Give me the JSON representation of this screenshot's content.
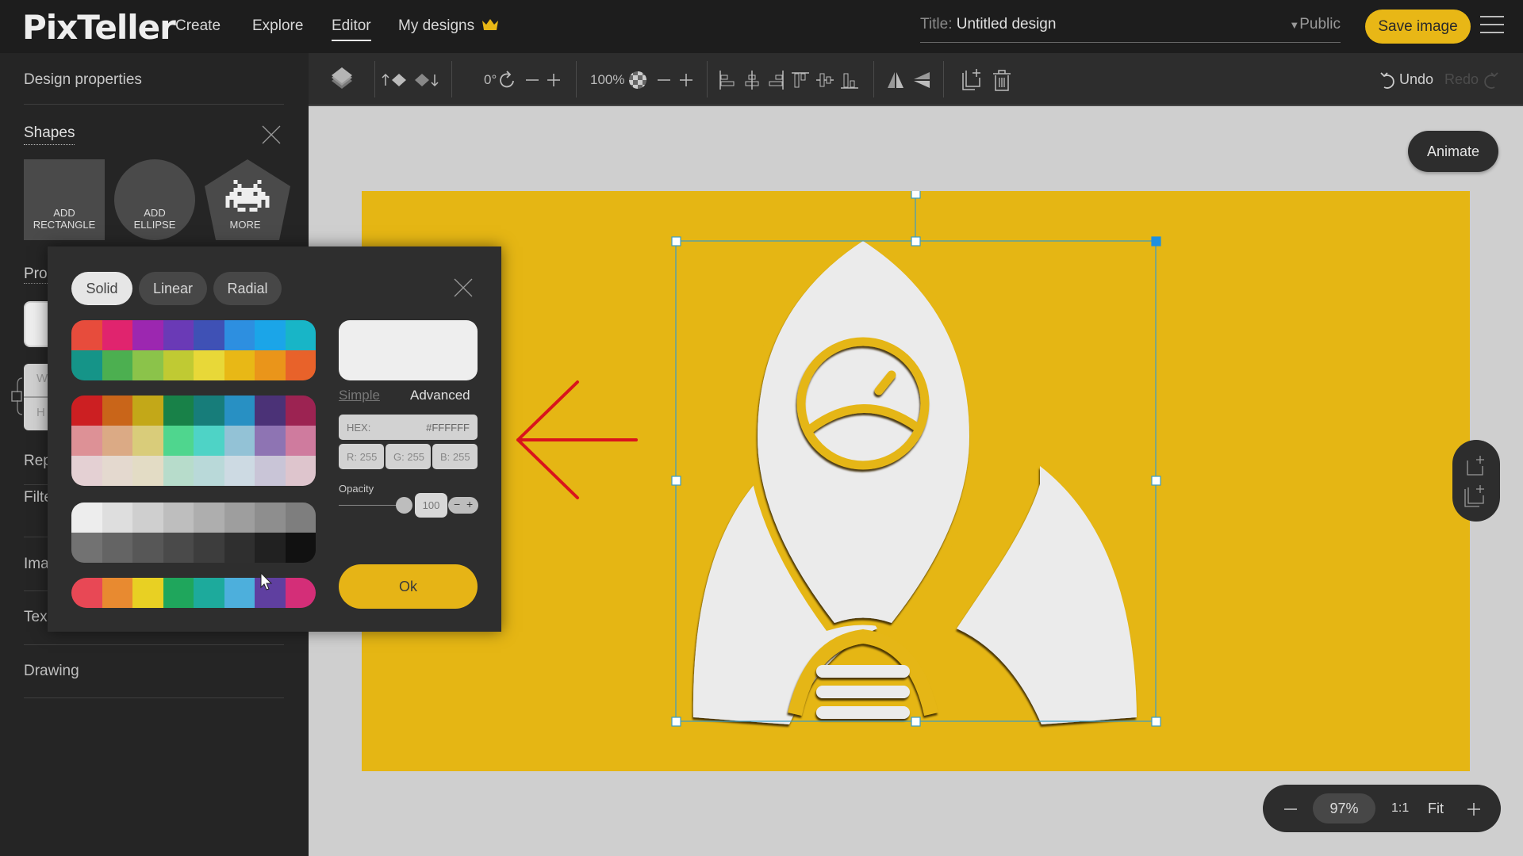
{
  "app": {
    "logo": "PixTeller",
    "nav": [
      {
        "label": "Create",
        "active": false
      },
      {
        "label": "Explore",
        "active": false
      },
      {
        "label": "Editor",
        "active": true
      },
      {
        "label": "My designs",
        "active": false,
        "icon": "crown-icon"
      }
    ],
    "title_label": "Title:",
    "title_value": "Untitled design",
    "visibility": "Public",
    "save_label": "Save image",
    "menu_icon": "hamburger-icon",
    "accent_color": "#E8B716"
  },
  "sidebar": {
    "design_properties": "Design properties",
    "shapes": {
      "title": "Shapes",
      "buttons": [
        {
          "line1": "ADD",
          "line2": "RECTANGLE"
        },
        {
          "line1": "ADD",
          "line2": "ELLIPSE"
        },
        {
          "line1": "",
          "line2": "MORE"
        }
      ]
    },
    "properties_label": "Prop",
    "width_label": "W",
    "height_label": "H",
    "items": [
      "Rep",
      "Filte",
      "Ima",
      "Tex",
      "Drawing"
    ]
  },
  "toolbar": {
    "rotation": "0°",
    "zoom": "100%",
    "undo": "Undo",
    "redo": "Redo",
    "icons": [
      "layers-icon",
      "bring-forward-icon",
      "send-backward-icon",
      "rotate-icon",
      "minus-icon",
      "plus-icon",
      "transparency-icon",
      "minus-icon",
      "plus-icon",
      "align-left-icon",
      "align-center-icon",
      "align-right-icon",
      "align-top-icon",
      "align-middle-icon",
      "align-bottom-icon",
      "flip-horizontal-icon",
      "flip-vertical-icon",
      "duplicate-icon",
      "delete-icon",
      "undo-icon",
      "redo-icon"
    ]
  },
  "canvas": {
    "background_color": "#E5B614",
    "animate_label": "Animate",
    "zoom_bar": {
      "level": "97%",
      "one_to_one": "1:1",
      "fit": "Fit"
    }
  },
  "color_picker": {
    "tabs": [
      {
        "label": "Solid",
        "active": true
      },
      {
        "label": "Linear",
        "active": false
      },
      {
        "label": "Radial",
        "active": false
      }
    ],
    "palettes": [
      [
        "#E74C3C",
        "#E0246E",
        "#9C27B0",
        "#6A3AB6",
        "#3F51B5",
        "#2D8FE0",
        "#1BA5E8",
        "#18B5C7",
        "#159488",
        "#4CAF50",
        "#8BC34A",
        "#C0CA33",
        "#E8D838",
        "#E8B816",
        "#EA951A",
        "#E8622A"
      ],
      [
        "#CC1F22",
        "#C96519",
        "#C3A818",
        "#188148",
        "#177D7A",
        "#2890C3",
        "#4B3277",
        "#9C2352",
        "#DD9196",
        "#DBAA85",
        "#D9CC7A",
        "#4FD68E",
        "#4ED3C6",
        "#93C2D6",
        "#8E74B3",
        "#CF7B9E",
        "#E4D0D3",
        "#E4D9CF",
        "#E3DCC5",
        "#B7DCCB",
        "#B9D9D9",
        "#CDDAE3",
        "#C9C5D7",
        "#DEC5CD"
      ],
      [
        "#EDEDED",
        "#DEDEDE",
        "#CFCFCF",
        "#BEBEBE",
        "#AEAEAE",
        "#9E9E9E",
        "#8E8E8E",
        "#7E7E7E",
        "#727272",
        "#646464",
        "#575757",
        "#4A4A4A",
        "#3D3D3D",
        "#2F2F2F",
        "#212121",
        "#111111"
      ],
      [
        "#E84855",
        "#E88A30",
        "#E8D023",
        "#1FA65C",
        "#1DAA9C",
        "#4DAFDC",
        "#5F3FA0",
        "#D42E78"
      ]
    ],
    "preview_color": "#EEEEEE",
    "mode_simple": "Simple",
    "mode_advanced": "Advanced",
    "hex_label": "HEX:",
    "hex_value": "#FFFFFF",
    "r": "R: 255",
    "g": "G: 255",
    "b": "B: 255",
    "opacity_label": "Opacity",
    "opacity_value": "100",
    "ok_label": "Ok"
  },
  "annotation": {
    "type": "arrow",
    "direction": "left",
    "color": "#D9141C"
  }
}
